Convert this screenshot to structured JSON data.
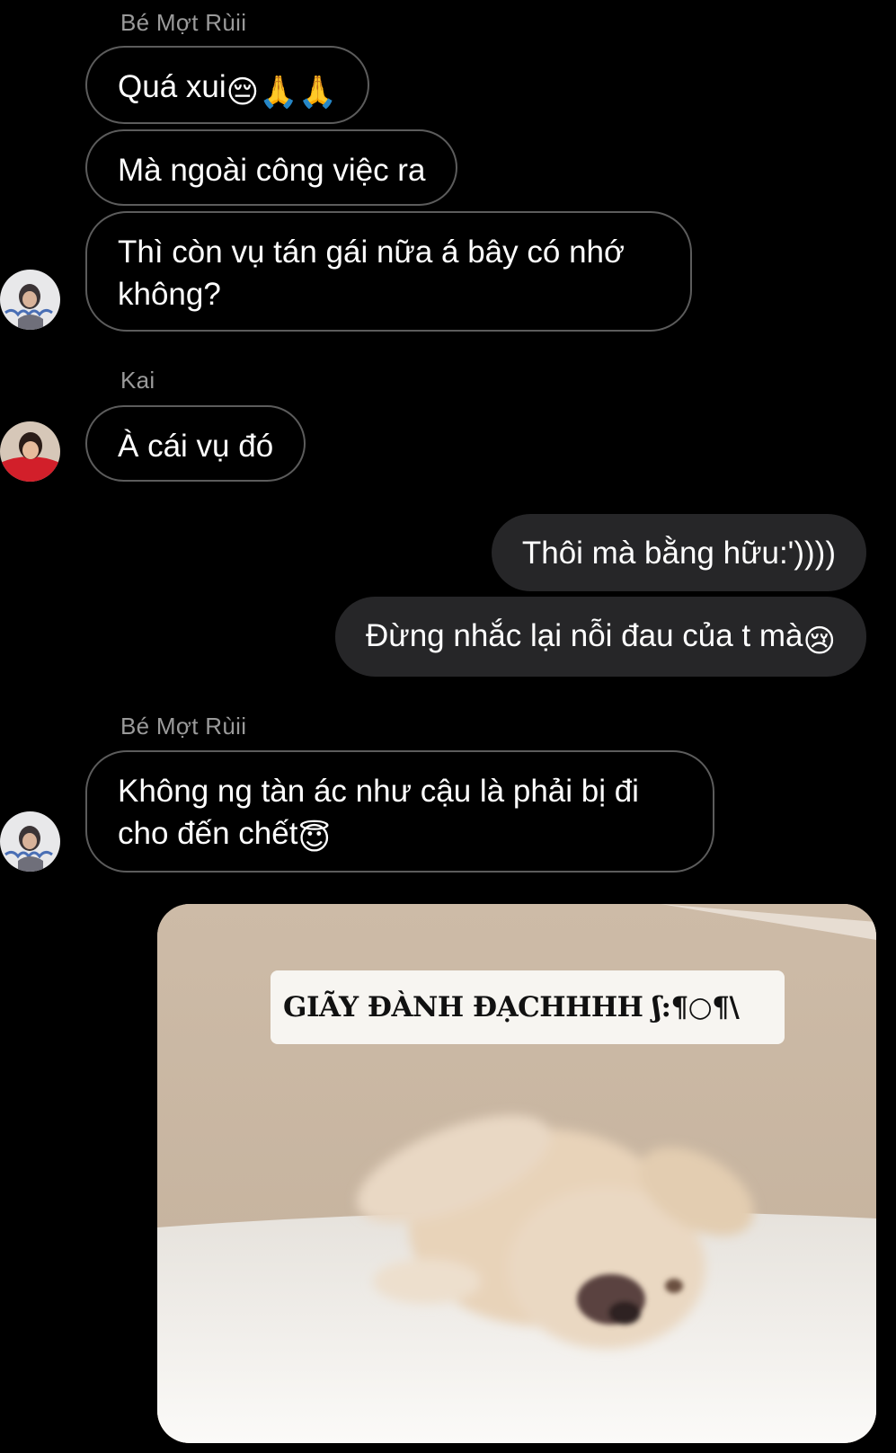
{
  "conversation": {
    "groups": [
      {
        "sender": "Bé Mợt Rùii",
        "messages": [
          {
            "text": "Quá xui",
            "emoji": "😔🙏🙏"
          },
          {
            "text": "Mà ngoài công việc ra",
            "emoji": ""
          },
          {
            "text": "Thì còn vụ tán gái nữa á bây có nhớ không?",
            "emoji": ""
          }
        ]
      },
      {
        "sender": "Kai",
        "messages": [
          {
            "text": "À cái vụ đó",
            "emoji": ""
          }
        ]
      },
      {
        "sender": "me",
        "messages": [
          {
            "text": "Thôi mà bằng hữu:'))))",
            "emoji": ""
          },
          {
            "text": "Đừng nhắc lại nỗi đau của t mà",
            "emoji": "😢"
          }
        ]
      },
      {
        "sender": "Bé Mợt Rùii",
        "messages": [
          {
            "text": "Không ng tàn ác như cậu là phải bị đi cho đến chết",
            "emoji": "😇"
          }
        ]
      }
    ],
    "meme": {
      "caption": "GIÃY ĐÀNH ĐẠCHHHH ʃ:¶○¶\\"
    }
  },
  "colors": {
    "background": "#000000",
    "incoming_border": "#5c5c5c",
    "outgoing_bubble": "#262628",
    "sender_name": "#9a9a9a",
    "text": "#ffffff"
  }
}
